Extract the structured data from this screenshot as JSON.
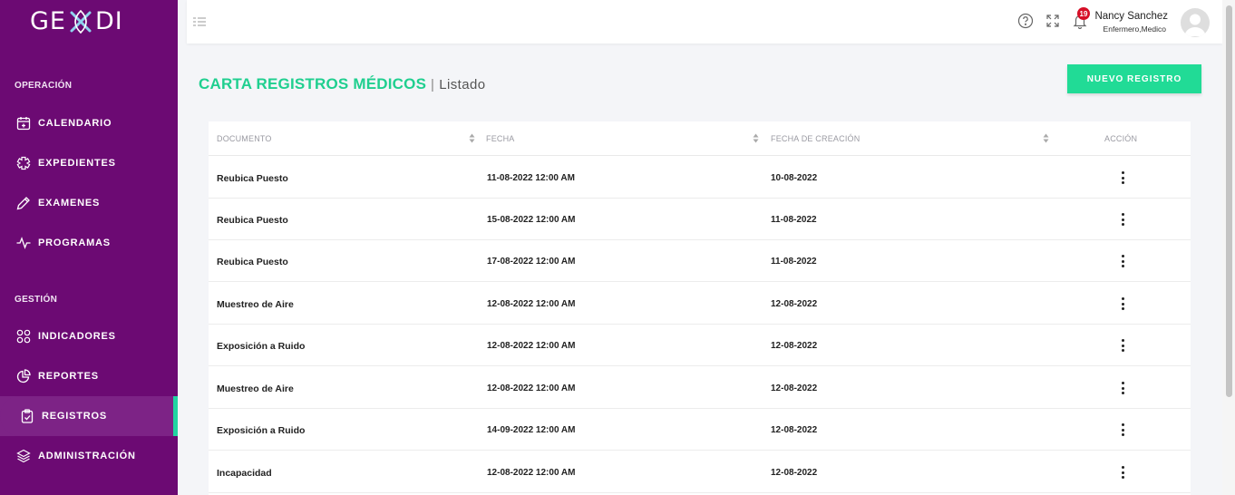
{
  "app": {
    "logo_left": "GE",
    "logo_right": "DI"
  },
  "colors": {
    "sidebar_bg": "#6c0a73",
    "accent_green": "#21db96",
    "active_indicator": "#21d4a1",
    "notification_badge": "#d60f27"
  },
  "sidebar": {
    "sections": [
      {
        "title": "OPERACIÓN",
        "items": [
          {
            "label": "CALENDARIO",
            "icon": "calendar-plus-icon"
          },
          {
            "label": "EXPEDIENTES",
            "icon": "medical-cross-icon"
          },
          {
            "label": "EXAMENES",
            "icon": "pen-icon"
          },
          {
            "label": "PROGRAMAS",
            "icon": "pulse-icon"
          }
        ]
      },
      {
        "title": "GESTIÓN",
        "items": [
          {
            "label": "INDICADORES",
            "icon": "grid-icon"
          },
          {
            "label": "REPORTES",
            "icon": "pie-chart-icon"
          },
          {
            "label": "REGISTROS",
            "icon": "clipboard-check-icon",
            "active": true
          },
          {
            "label": "ADMINISTRACIÓN",
            "icon": "layers-icon"
          }
        ]
      }
    ]
  },
  "topbar": {
    "notification_count": "19",
    "user_name": "Nancy Sanchez",
    "user_role": "Enfermero,Medico"
  },
  "page": {
    "title": "CARTA REGISTROS MÉDICOS",
    "separator": "|",
    "subtitle": "Listado",
    "new_button": "NUEVO REGISTRO"
  },
  "table": {
    "columns": [
      "DOCUMENTO",
      "FECHA",
      "FECHA DE CREACIÓN",
      "ACCIÓN"
    ],
    "rows": [
      {
        "documento": "Reubica Puesto",
        "fecha": "11-08-2022 12:00 AM",
        "creacion": "10-08-2022"
      },
      {
        "documento": "Reubica Puesto",
        "fecha": "15-08-2022 12:00 AM",
        "creacion": "11-08-2022"
      },
      {
        "documento": "Reubica Puesto",
        "fecha": "17-08-2022 12:00 AM",
        "creacion": "11-08-2022"
      },
      {
        "documento": "Muestreo de Aire",
        "fecha": "12-08-2022 12:00 AM",
        "creacion": "12-08-2022"
      },
      {
        "documento": "Exposición a Ruido",
        "fecha": "12-08-2022 12:00 AM",
        "creacion": "12-08-2022"
      },
      {
        "documento": "Muestreo de Aire",
        "fecha": "12-08-2022 12:00 AM",
        "creacion": "12-08-2022"
      },
      {
        "documento": "Exposición a Ruido",
        "fecha": "14-09-2022 12:00 AM",
        "creacion": "12-08-2022"
      },
      {
        "documento": "Incapacidad",
        "fecha": "12-08-2022 12:00 AM",
        "creacion": "12-08-2022"
      }
    ]
  }
}
